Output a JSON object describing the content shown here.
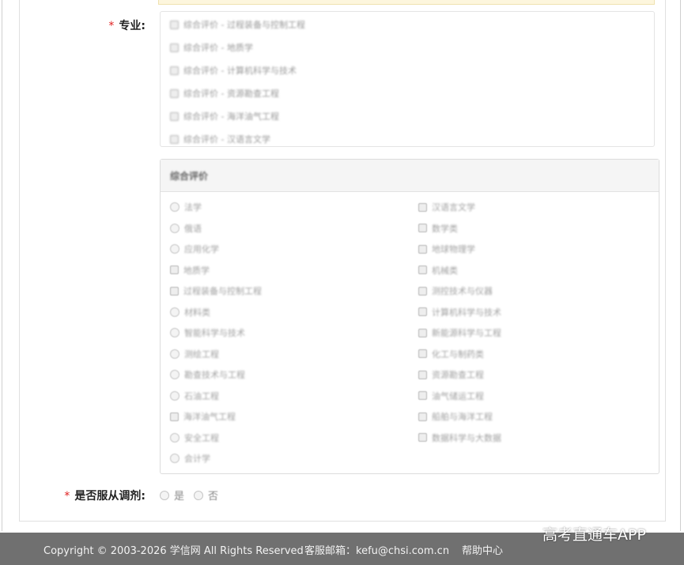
{
  "form": {
    "major": {
      "required_mark": "*",
      "label": "专业:",
      "selected": [
        {
          "text": "综合评价 - 过程装备与控制工程",
          "checked": true
        },
        {
          "text": "综合评价 - 地质学",
          "checked": true
        },
        {
          "text": "综合评价 - 计算机科学与技术",
          "checked": true
        },
        {
          "text": "综合评价 - 资源勘查工程",
          "checked": true
        },
        {
          "text": "综合评价 - 海洋油气工程",
          "checked": true
        },
        {
          "text": "综合评价 - 汉语言文学",
          "checked": true
        }
      ],
      "panel_title": "综合评价",
      "options_left": [
        {
          "text": "法学",
          "control": "radio"
        },
        {
          "text": "俄语",
          "control": "radio"
        },
        {
          "text": "应用化学",
          "control": "radio"
        },
        {
          "text": "地质学",
          "control": "checkbox",
          "checked": true
        },
        {
          "text": "过程装备与控制工程",
          "control": "checkbox",
          "checked": true
        },
        {
          "text": "材料类",
          "control": "radio"
        },
        {
          "text": "智能科学与技术",
          "control": "radio"
        },
        {
          "text": "测绘工程",
          "control": "radio"
        },
        {
          "text": "勘查技术与工程",
          "control": "radio"
        },
        {
          "text": "石油工程",
          "control": "radio"
        },
        {
          "text": "海洋油气工程",
          "control": "checkbox",
          "checked": true
        },
        {
          "text": "安全工程",
          "control": "radio"
        },
        {
          "text": "会计学",
          "control": "radio"
        }
      ],
      "options_right": [
        {
          "text": "汉语言文学",
          "control": "checkbox",
          "checked": true
        },
        {
          "text": "数学类",
          "control": "checkbox"
        },
        {
          "text": "地球物理学",
          "control": "checkbox"
        },
        {
          "text": "机械类",
          "control": "checkbox"
        },
        {
          "text": "测控技术与仪器",
          "control": "checkbox"
        },
        {
          "text": "计算机科学与技术",
          "control": "checkbox",
          "checked": true
        },
        {
          "text": "新能源科学与工程",
          "control": "checkbox"
        },
        {
          "text": "化工与制药类",
          "control": "checkbox"
        },
        {
          "text": "资源勘查工程",
          "control": "checkbox",
          "checked": true
        },
        {
          "text": "油气储运工程",
          "control": "checkbox"
        },
        {
          "text": "船舶与海洋工程",
          "control": "checkbox"
        },
        {
          "text": "数据科学与大数据",
          "control": "checkbox"
        }
      ]
    },
    "transfer": {
      "required_mark": "*",
      "label": "是否服从调剂:",
      "options": [
        "是",
        "否"
      ]
    }
  },
  "footer": {
    "copyright": "Copyright © 2003-2026 学信网 All Rights Reserved",
    "service_email": "客服邮箱：kefu@chsi.com.cn",
    "help": "帮助中心"
  },
  "watermark": "高考直通车APP"
}
